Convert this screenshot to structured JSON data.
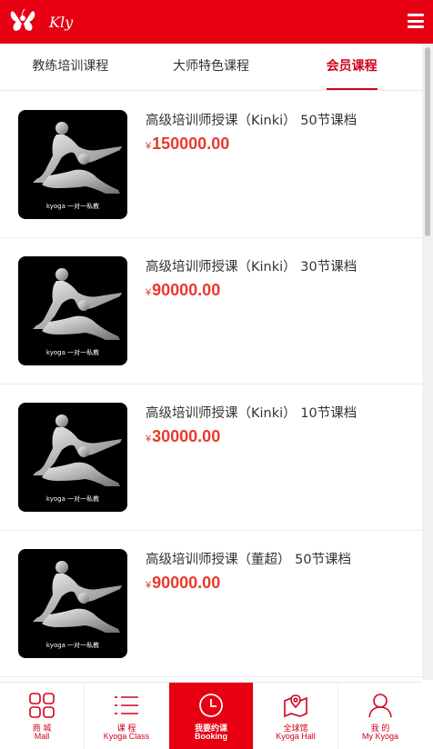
{
  "header": {
    "logo_text": "Kly",
    "menu_icon": "hamburger-menu-icon",
    "background": "#e60012"
  },
  "tabs": [
    {
      "label": "教练培训课程",
      "active": false
    },
    {
      "label": "大师特色课程",
      "active": false
    },
    {
      "label": "会员课程",
      "active": true
    }
  ],
  "products": [
    {
      "title": "高级培训师授课（Kinki） 50节课档",
      "currency": "¥",
      "price": "150000.00",
      "image_caption": "kyoga 一对一私教"
    },
    {
      "title": "高级培训师授课（Kinki） 30节课档",
      "currency": "¥",
      "price": "90000.00",
      "image_caption": "kyoga 一对一私教"
    },
    {
      "title": "高级培训师授课（Kinki） 10节课档",
      "currency": "¥",
      "price": "30000.00",
      "image_caption": "kyoga 一对一私教"
    },
    {
      "title": "高级培训师授课（董超） 50节课档",
      "currency": "¥",
      "price": "90000.00",
      "image_caption": "kyoga 一对一私教"
    }
  ],
  "bottom_nav": [
    {
      "cn": "商 城",
      "en": "Mall",
      "icon": "grid-icon",
      "active": false
    },
    {
      "cn": "课 程",
      "en": "Kyoga Class",
      "icon": "list-icon",
      "active": false
    },
    {
      "cn": "我要约课",
      "en": "Booking",
      "icon": "clock-icon",
      "active": true
    },
    {
      "cn": "全球馆",
      "en": "Kyoga Hall",
      "icon": "map-icon",
      "active": false
    },
    {
      "cn": "我 的",
      "en": "My Kyoga",
      "icon": "person-icon",
      "active": false
    }
  ],
  "colors": {
    "brand_red": "#e60012",
    "price_red": "#e83a2e",
    "tab_active": "#d0021b"
  }
}
